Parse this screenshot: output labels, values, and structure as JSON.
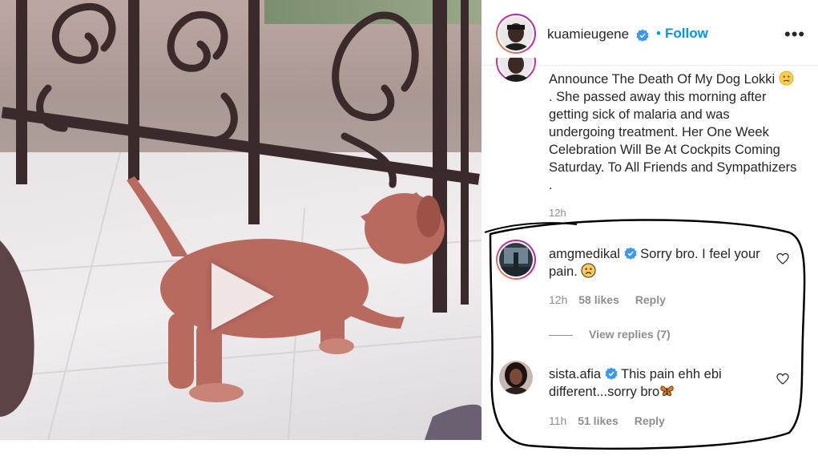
{
  "post": {
    "username": "kuamieugene",
    "follow_label": "Follow",
    "follow_separator": "•",
    "more_label": "•••",
    "caption": "Announce The Death Of My Dog Lokki",
    "caption_continued": ". She passed away this morning after getting sick of malaria and was undergoing treatment. Her One Week Celebration Will Be At Cockpits Coming Saturday. To All Friends and Sympathizers .",
    "caption_time": "12h"
  },
  "comments": [
    {
      "username": "amgmedikal",
      "text": "Sorry bro. I feel your pain.",
      "time": "12h",
      "likes": "58 likes",
      "reply_label": "Reply",
      "view_replies": "View replies (7)"
    },
    {
      "username": "sista.afia",
      "text": "This pain ehh ebi different...sorry bro",
      "time": "11h",
      "likes": "51 likes",
      "reply_label": "Reply"
    }
  ],
  "icons": {
    "verified": "verified-badge-icon",
    "heart": "heart-icon",
    "play": "play-icon",
    "sad_emoji": "sad-face-emoji",
    "butterfly_emoji": "butterfly-emoji"
  },
  "colors": {
    "accent": "#0095f6",
    "muted": "#8e8e8e",
    "text": "#262626"
  }
}
